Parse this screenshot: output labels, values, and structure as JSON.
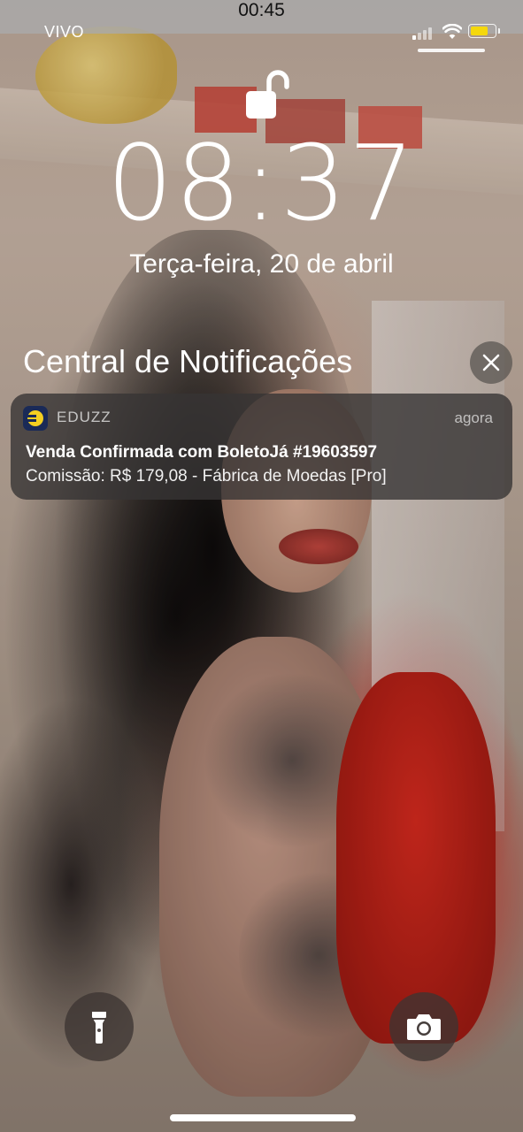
{
  "status_bar": {
    "time": "00:45",
    "carrier": "VIVO",
    "battery_level": 0.75,
    "battery_color": "#f5d80c"
  },
  "lock_screen": {
    "lock_icon": "unlocked-padlock-icon",
    "clock": "08:37",
    "date": "Terça-feira, 20 de abril"
  },
  "notification_center": {
    "title": "Central de Notificações",
    "close_icon": "close-icon"
  },
  "notification": {
    "app_icon": "eduzz-app-icon",
    "app_name": "EDUZZ",
    "time": "agora",
    "title": "Venda Confirmada com BoletoJá #19603597",
    "body": "Comissão: R$ 179,08 - Fábrica de Moedas [Pro]"
  },
  "controls": {
    "flashlight_icon": "flashlight-icon",
    "camera_icon": "camera-icon"
  }
}
